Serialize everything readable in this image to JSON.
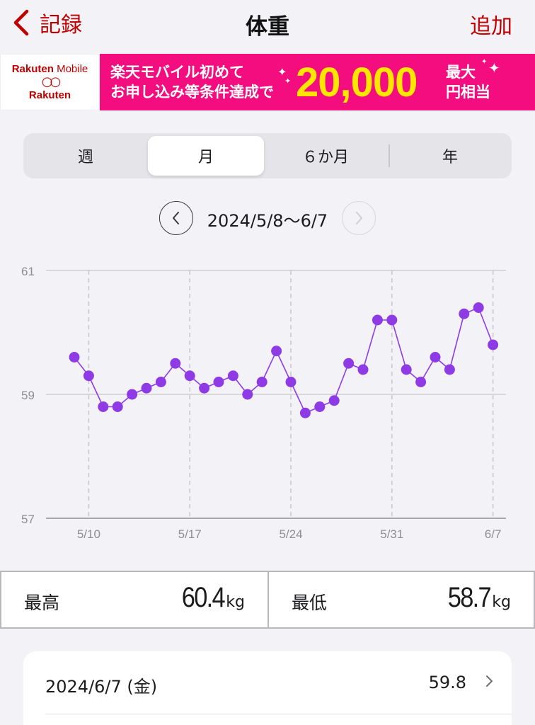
{
  "header": {
    "back_label": "記録",
    "title": "体重",
    "add_label": "追加"
  },
  "banner": {
    "logo_top_prefix": "Rakuten",
    "logo_top_suffix": " Mobile",
    "logo_bottom": "Rakuten",
    "line1": "楽天モバイル初めて",
    "line2": "お申し込み等条件達成で",
    "amount": "20,000",
    "suffix_line1": "最大",
    "suffix_line2": "円相当",
    "bg_color": "#f30d7f",
    "amount_color": "#ffe600"
  },
  "segments": {
    "items": [
      "週",
      "月",
      "６か月",
      "年"
    ],
    "selected": "月"
  },
  "date_nav": {
    "range": "2024/5/8〜6/7"
  },
  "chart_data": {
    "type": "line",
    "x": [
      "5/9",
      "5/10",
      "5/11",
      "5/12",
      "5/13",
      "5/14",
      "5/15",
      "5/16",
      "5/17",
      "5/18",
      "5/19",
      "5/20",
      "5/21",
      "5/22",
      "5/23",
      "5/24",
      "5/25",
      "5/26",
      "5/27",
      "5/28",
      "5/29",
      "5/30",
      "5/31",
      "6/1",
      "6/2",
      "6/3",
      "6/4",
      "6/5",
      "6/6",
      "6/7"
    ],
    "values": [
      59.6,
      59.3,
      58.8,
      58.8,
      59.0,
      59.1,
      59.2,
      59.5,
      59.3,
      59.1,
      59.2,
      59.3,
      59.0,
      59.2,
      59.7,
      59.2,
      58.7,
      58.8,
      58.9,
      59.5,
      59.4,
      60.2,
      60.2,
      59.4,
      59.2,
      59.6,
      59.4,
      60.3,
      60.4,
      59.8
    ],
    "xticks": [
      "5/10",
      "5/17",
      "5/24",
      "5/31",
      "6/7"
    ],
    "yticks": [
      "57",
      "59",
      "61"
    ],
    "ylim": [
      57,
      61
    ],
    "grid": true,
    "color": "#8e3be6"
  },
  "stats": {
    "max_label": "最高",
    "max_value": "60.4",
    "min_label": "最低",
    "min_value": "58.7",
    "unit": "kg"
  },
  "entries": [
    {
      "date": "2024/6/7 (金)",
      "value": "59.8"
    }
  ],
  "accent_color": "#bf0000"
}
